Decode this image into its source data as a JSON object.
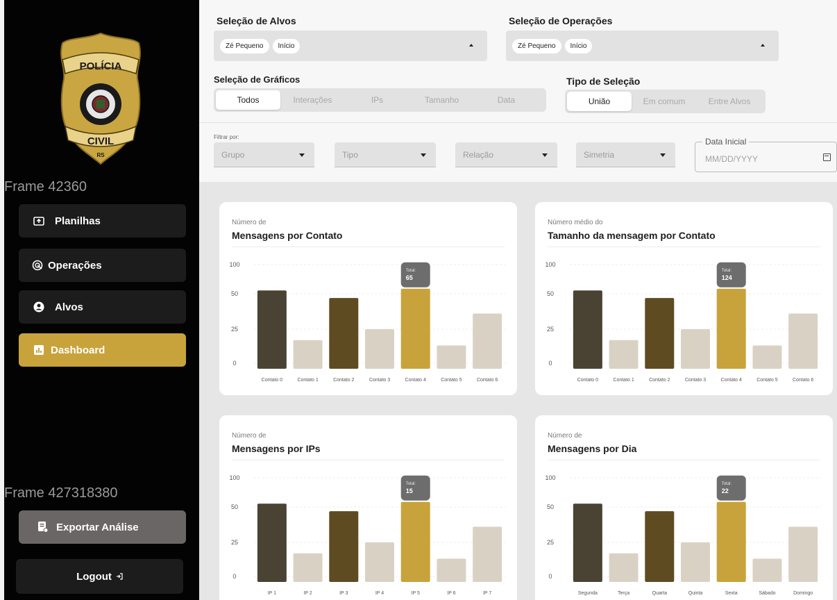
{
  "sidebar": {
    "badge": {
      "top": "POLÍCIA",
      "bottom": "CIVIL",
      "state": "RS"
    },
    "frame1": "Frame 42360",
    "frame2": "Frame 427318380",
    "nav": [
      {
        "label": "Planilhas",
        "icon": "folder-upload-icon",
        "active": false
      },
      {
        "label": "Operações",
        "icon": "radar-icon",
        "active": false
      },
      {
        "label": "Alvos",
        "icon": "user-circle-icon",
        "active": false
      },
      {
        "label": "Dashboard",
        "icon": "bar-chart-icon",
        "active": true
      }
    ],
    "export_label": "Exportar Análise",
    "logout_label": "Logout",
    "colors": {
      "active": "#c8a33b",
      "bg": "#030303",
      "item": "#1c1c1c"
    }
  },
  "top": {
    "alvos": {
      "title": "Seleção de Alvos",
      "chips": [
        "Zé Pequeno",
        "Início"
      ]
    },
    "operacoes": {
      "title": "Seleção de Operações",
      "chips": [
        "Zé Pequeno",
        "Início"
      ]
    },
    "graficos": {
      "title": "Seleção de Gráficos",
      "options": [
        "Todos",
        "Interações",
        "IPs",
        "Tamanho",
        "Data"
      ],
      "selected": "Todos"
    },
    "tipo": {
      "title": "Tipo de Seleção",
      "options": [
        "União",
        "Em comum",
        "Entre Alvos"
      ],
      "selected": "União"
    },
    "filter": {
      "label": "Filtrar por:",
      "dropdowns": [
        "Grupo",
        "Tipo",
        "Relação",
        "Simetria"
      ]
    },
    "date": {
      "label": "Data Inicial",
      "placeholder": "MM/DD/YYYY"
    }
  },
  "cards": [
    {
      "subtitle": "Número de",
      "title": "Mensagens por Contato"
    },
    {
      "subtitle": "Número médio do",
      "title": "Tamanho da mensagem por Contato"
    },
    {
      "subtitle": "Número de",
      "title": "Mensagens por IPs"
    },
    {
      "subtitle": "Número de",
      "title": "Mensagens por Dia"
    }
  ],
  "chart_data": [
    {
      "type": "bar",
      "title": "Mensagens por Contato",
      "categories": [
        "Contato 0",
        "Contato 1",
        "Contato 2",
        "Contato 3",
        "Contato 4",
        "Contato 5",
        "Contato 6"
      ],
      "values": [
        58,
        18,
        48,
        26,
        61,
        14,
        37
      ],
      "yticks": [
        "100",
        "50",
        "25",
        "0"
      ],
      "highlight": {
        "index": 4,
        "label": "Total:",
        "value": "65"
      },
      "colors": [
        "#4a4334",
        "#d9d2c4",
        "#5f4b22",
        "#d9d2c4",
        "#c8a33b",
        "#d9d2c4",
        "#d9d2c4"
      ]
    },
    {
      "type": "bar",
      "title": "Tamanho da mensagem por Contato",
      "categories": [
        "Contato 0",
        "Contato 1",
        "Contato 2",
        "Contato 3",
        "Contato 4",
        "Contato 5",
        "Contato 6"
      ],
      "values": [
        58,
        18,
        48,
        26,
        61,
        14,
        37
      ],
      "yticks": [
        "100",
        "50",
        "25",
        "0"
      ],
      "highlight": {
        "index": 4,
        "label": "Total:",
        "value": "124"
      },
      "colors": [
        "#4a4334",
        "#d9d2c4",
        "#5f4b22",
        "#d9d2c4",
        "#c8a33b",
        "#d9d2c4",
        "#d9d2c4"
      ]
    },
    {
      "type": "bar",
      "title": "Mensagens por IPs",
      "categories": [
        "IP 1",
        "IP 2",
        "IP 3",
        "IP 4",
        "IP 5",
        "IP 6",
        "IP 7"
      ],
      "values": [
        58,
        18,
        48,
        26,
        61,
        14,
        37
      ],
      "yticks": [
        "100",
        "50",
        "25",
        "0"
      ],
      "highlight": {
        "index": 4,
        "label": "Total:",
        "value": "15"
      },
      "colors": [
        "#4a4334",
        "#d9d2c4",
        "#5f4b22",
        "#d9d2c4",
        "#c8a33b",
        "#d9d2c4",
        "#d9d2c4"
      ]
    },
    {
      "type": "bar",
      "title": "Mensagens por Dia",
      "categories": [
        "Segunda",
        "Terça",
        "Quarta",
        "Quinta",
        "Sexta",
        "Sábado",
        "Domingo"
      ],
      "values": [
        58,
        18,
        48,
        26,
        61,
        14,
        37
      ],
      "yticks": [
        "100",
        "50",
        "25",
        "0"
      ],
      "highlight": {
        "index": 4,
        "label": "Total:",
        "value": "22"
      },
      "colors": [
        "#4a4334",
        "#d9d2c4",
        "#5f4b22",
        "#d9d2c4",
        "#c8a33b",
        "#d9d2c4",
        "#d9d2c4"
      ]
    }
  ]
}
